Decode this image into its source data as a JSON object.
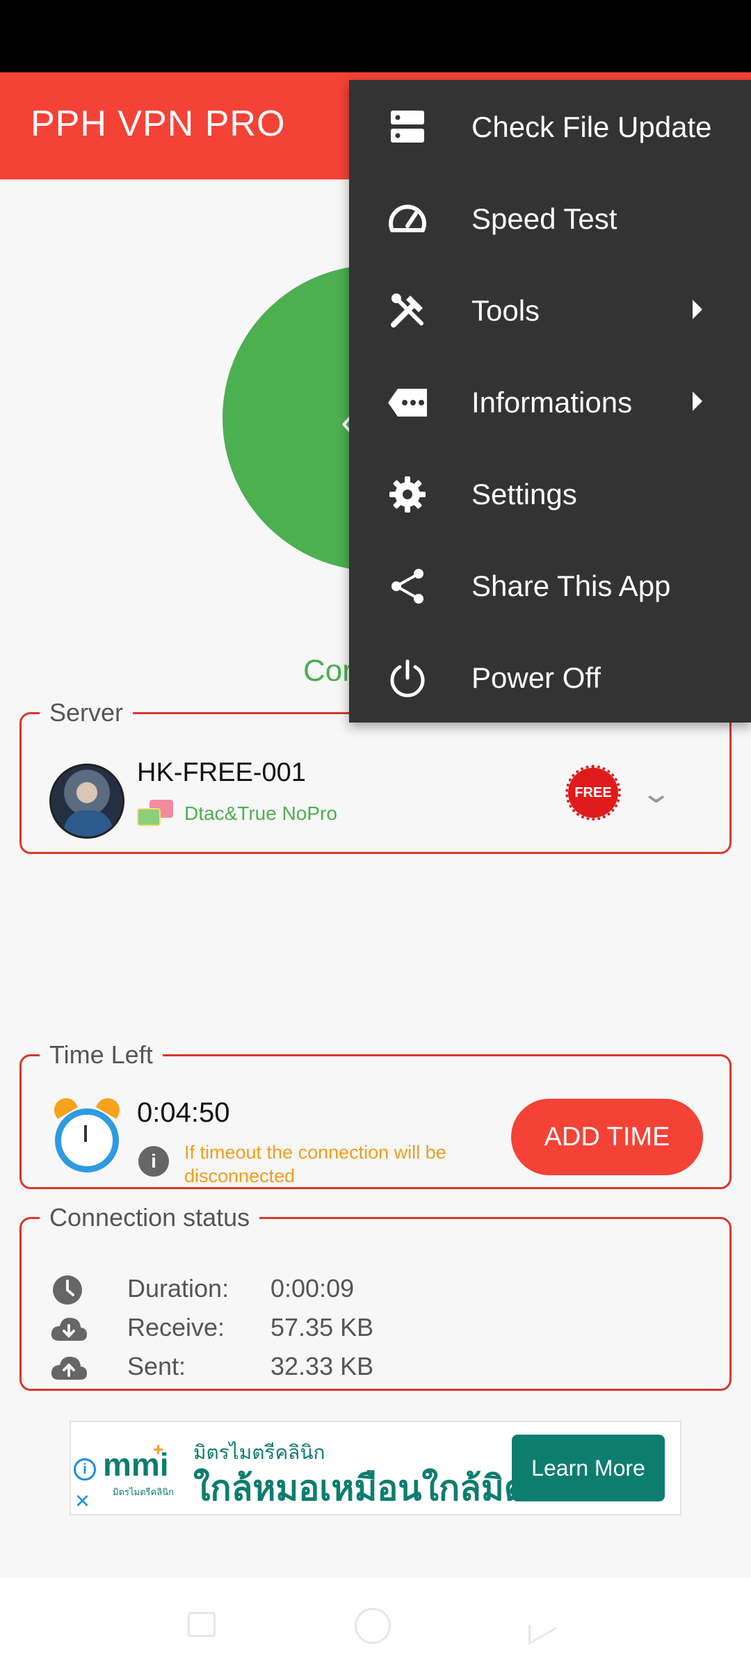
{
  "app": {
    "title": "PPH VPN PRO"
  },
  "connection_label": "Cor",
  "server": {
    "legend": "Server",
    "name": "HK-FREE-001",
    "network": "Dtac&True NoPro",
    "badge": "FREE"
  },
  "time": {
    "legend": "Time Left",
    "remaining": "0:04:50",
    "note": "If timeout the connection will be disconnected",
    "add_button": "ADD TIME"
  },
  "connection_status": {
    "legend": "Connection status",
    "rows": [
      {
        "label": "Duration:",
        "value": "0:00:09",
        "icon": "clock-icon"
      },
      {
        "label": "Receive:",
        "value": "57.35 KB",
        "icon": "cloud-download-icon"
      },
      {
        "label": "Sent:",
        "value": "32.33 KB",
        "icon": "cloud-upload-icon"
      }
    ]
  },
  "ad": {
    "logo": "mmi",
    "logo_sub": "มิตรไมตรีคลินิก",
    "line1": "มิตรไมตรีคลินิก",
    "line2": "ใกล้หมอเหมือนใกล้มิตร",
    "button": "Learn More"
  },
  "menu": {
    "items": [
      {
        "label": "Check File Update",
        "icon": "server-icon",
        "submenu": false
      },
      {
        "label": "Speed Test",
        "icon": "speedometer-icon",
        "submenu": false
      },
      {
        "label": "Tools",
        "icon": "tools-icon",
        "submenu": true
      },
      {
        "label": "Informations",
        "icon": "more-tag-icon",
        "submenu": true
      },
      {
        "label": "Settings",
        "icon": "gear-icon",
        "submenu": false
      },
      {
        "label": "Share This App",
        "icon": "share-icon",
        "submenu": false
      },
      {
        "label": "Power Off",
        "icon": "power-icon",
        "submenu": false
      }
    ]
  },
  "colors": {
    "primary": "#f44236",
    "connected": "#4caf50",
    "menu_bg": "#333333",
    "warning": "#f39c1c",
    "ad_teal": "#0d7d6f"
  }
}
